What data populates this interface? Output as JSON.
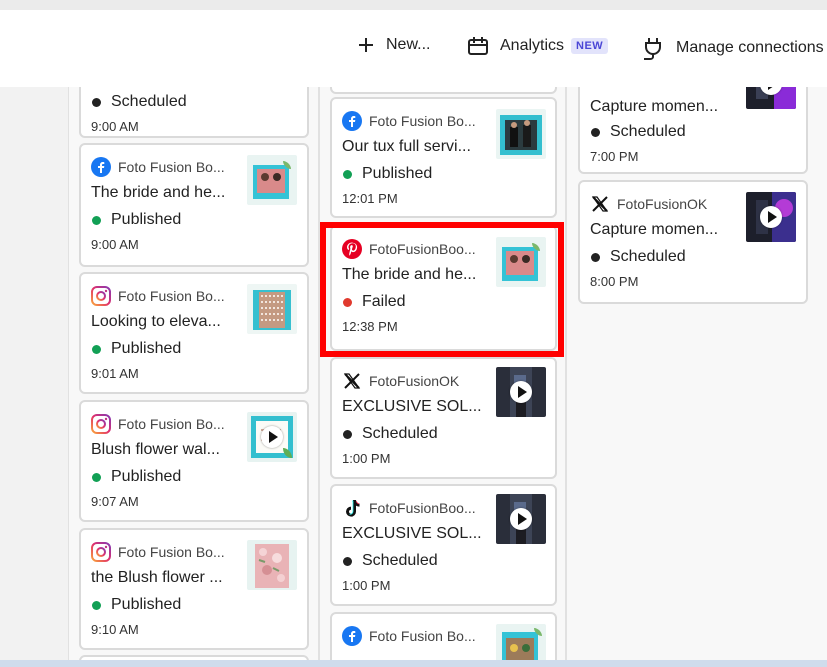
{
  "toolbar": {
    "new_label": "New...",
    "analytics_label": "Analytics",
    "analytics_badge": "NEW",
    "manage_label": "Manage connections"
  },
  "colors": {
    "published": "#12a055",
    "failed": "#e03a2e",
    "scheduled": "#222222",
    "highlight": "#ff0000",
    "badge_text": "#4b47d6",
    "badge_bg": "#e2e3fb"
  },
  "columns": [
    {
      "cards": [
        {
          "status": "Scheduled",
          "time": "9:00 AM"
        },
        {
          "platform": "facebook-icon",
          "account": "Foto Fusion Bo...",
          "title": "The bride and he...",
          "status": "Published",
          "time": "9:00 AM"
        },
        {
          "platform": "instagram-icon",
          "account": "Foto Fusion Bo...",
          "title": "Looking to eleva...",
          "status": "Published",
          "time": "9:01 AM"
        },
        {
          "platform": "instagram-icon",
          "account": "Foto Fusion Bo...",
          "title": "Blush flower wal...",
          "status": "Published",
          "time": "9:07 AM"
        },
        {
          "platform": "instagram-icon",
          "account": "Foto Fusion Bo...",
          "title": "the Blush flower ...",
          "status": "Published",
          "time": "9:10 AM"
        }
      ]
    },
    {
      "cards": [
        {
          "platform": "facebook-icon",
          "account": "Foto Fusion Bo...",
          "title": "Our tux full servi...",
          "status": "Published",
          "time": "12:01 PM"
        },
        {
          "platform": "pinterest-icon",
          "account": "FotoFusionBoo...",
          "title": "The bride and he...",
          "status": "Failed",
          "time": "12:38 PM"
        },
        {
          "platform": "x-icon",
          "account": "FotoFusionOK",
          "title": "EXCLUSIVE SOL...",
          "status": "Scheduled",
          "time": "1:00 PM"
        },
        {
          "platform": "tiktok-icon",
          "account": "FotoFusionBoo...",
          "title": "EXCLUSIVE SOL...",
          "status": "Scheduled",
          "time": "1:00 PM"
        },
        {
          "platform": "facebook-icon",
          "account": "Foto Fusion Bo..."
        }
      ]
    },
    {
      "cards": [
        {
          "title": "Capture momen...",
          "status": "Scheduled",
          "time": "7:00 PM"
        },
        {
          "platform": "x-icon",
          "account": "FotoFusionOK",
          "title": "Capture momen...",
          "status": "Scheduled",
          "time": "8:00 PM"
        }
      ]
    }
  ]
}
